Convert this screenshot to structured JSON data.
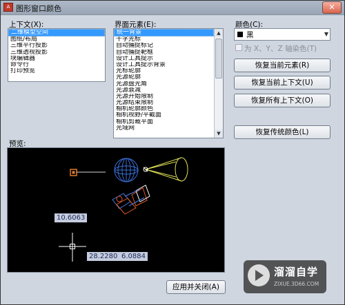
{
  "window": {
    "app_icon_text": "A",
    "title": "图形窗口颜色",
    "close_label": "✕"
  },
  "context": {
    "label": "上下文(X):",
    "items": [
      "二维模型空间",
      "图纸/布局",
      "三维平行投影",
      "三维透视投影",
      "块编辑器",
      "命令行",
      "打印预览"
    ],
    "selected_index": 0
  },
  "elements": {
    "label": "界面元素(E):",
    "items": [
      "统一背景",
      "十字光标",
      "自动捕捉标记",
      "自动捕捉靶框",
      "设计工具提示",
      "设计工具提示背景",
      "光标轮廓",
      "光源轮廓",
      "光源盘光角",
      "光源衰减",
      "光源开始限制",
      "光源结束限制",
      "相机轮廓颜色",
      "相机视野/平截面",
      "相机剪裁平面",
      "光域网"
    ],
    "selected_index": 0
  },
  "color": {
    "label": "颜色(C):",
    "value": "黑",
    "swatch": "#000000",
    "tint_checkbox_label": "为 X、Y、Z 轴染色(T)"
  },
  "buttons": {
    "restore_current_element": "恢复当前元素(R)",
    "restore_current_context": "恢复当前上下文(U)",
    "restore_all_contexts": "恢复所有上下文(O)",
    "restore_classic": "恢复传统颜色(L)",
    "apply_close": "应用并关闭(A)"
  },
  "preview": {
    "label": "预览:",
    "dim_1": "10.6063",
    "dim_2": "28.2280",
    "dim_3": "6.0884"
  },
  "watermark": {
    "text": "溜溜自学",
    "url": "ZIXUE.3D66.COM"
  },
  "colors": {
    "selection": "#3399ff",
    "preview_bg": "#000000",
    "dim_box": "#c5ccde"
  }
}
